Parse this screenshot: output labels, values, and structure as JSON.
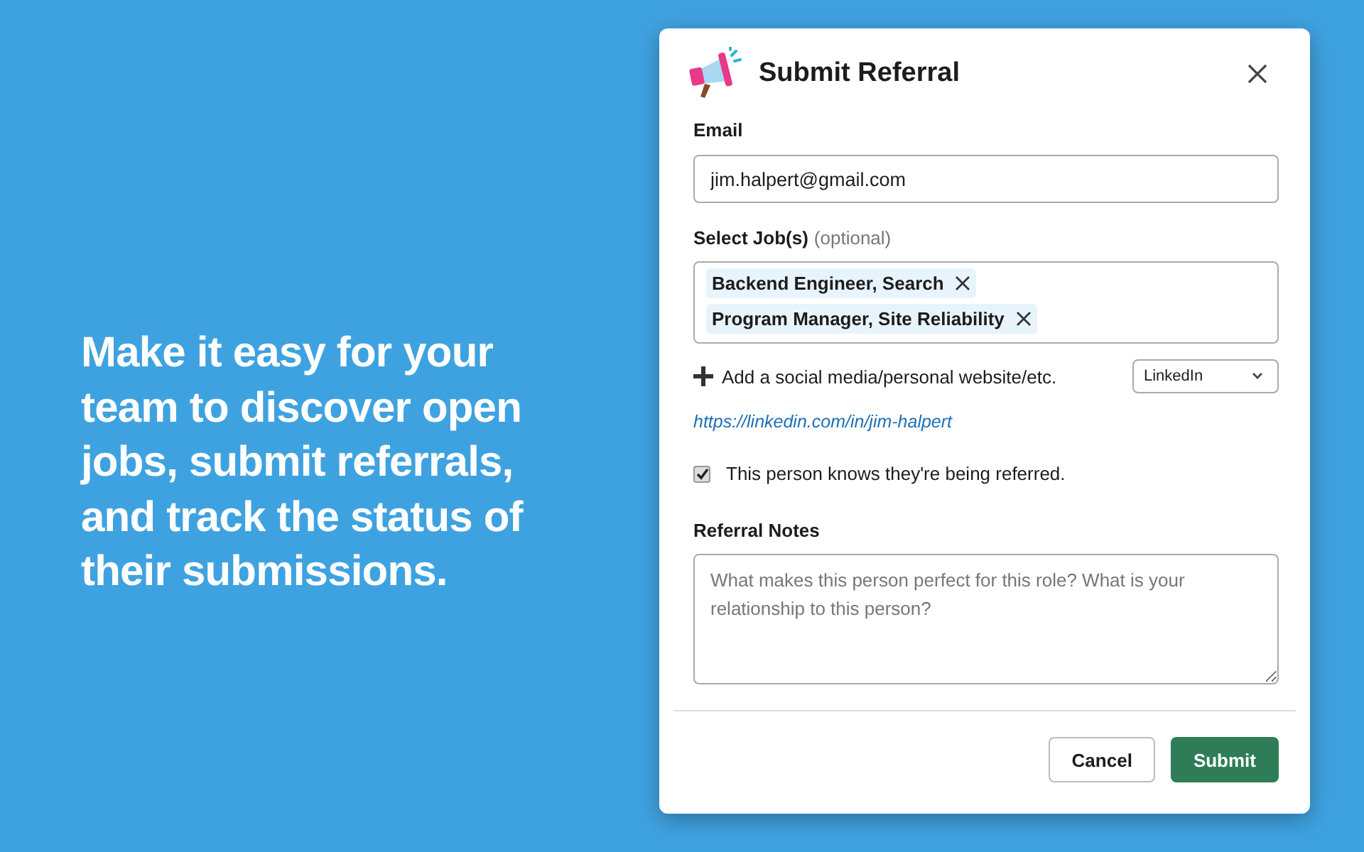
{
  "headline": "Make it easy for your team to discover open jobs, submit referrals, and track the status of their submissions.",
  "dialog": {
    "title": "Submit Referral",
    "email": {
      "label": "Email",
      "value": "jim.halpert@gmail.com"
    },
    "jobs": {
      "label": "Select Job(s)",
      "hint": "(optional)",
      "tags": [
        "Backend Engineer, Search",
        "Program Manager, Site Reliability"
      ]
    },
    "social": {
      "add_label": "Add a social media/personal website/etc.",
      "select_value": "LinkedIn",
      "link": "https://linkedin.com/in/jim-halpert"
    },
    "consent": {
      "label": "This person knows they're being referred.",
      "checked": true
    },
    "notes": {
      "label": "Referral Notes",
      "placeholder": "What makes this person perfect for this role? What is your relationship to this person?"
    },
    "buttons": [
      {
        "label": "Cancel",
        "kind": "secondary"
      },
      {
        "label": "Submit",
        "kind": "primary"
      }
    ]
  }
}
